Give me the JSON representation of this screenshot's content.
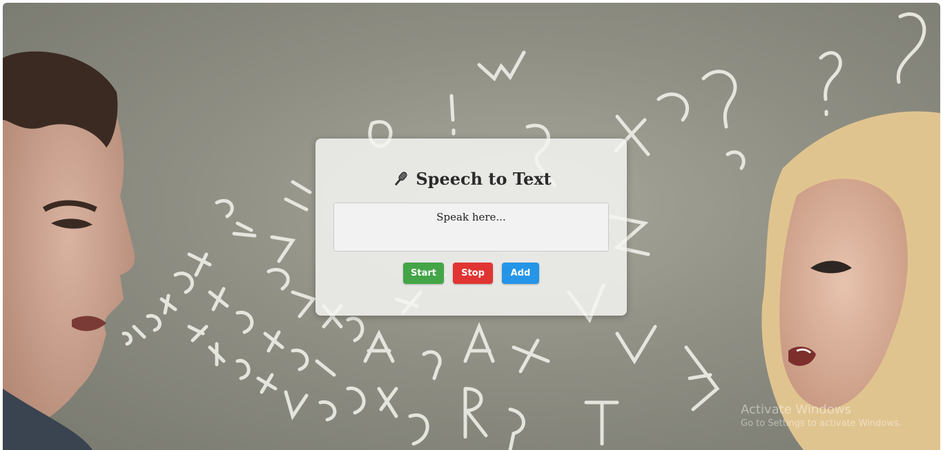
{
  "app": {
    "title": "Speech to Text",
    "icon": "microphone-icon"
  },
  "speech_area": {
    "placeholder": "Speak here..."
  },
  "buttons": {
    "start": "Start",
    "stop": "Stop",
    "add": "Add"
  },
  "colors": {
    "start": "#43a547",
    "stop": "#e03532",
    "add": "#2595e8"
  },
  "watermark": {
    "title": "Activate Windows",
    "subtitle": "Go to Settings to activate Windows."
  }
}
